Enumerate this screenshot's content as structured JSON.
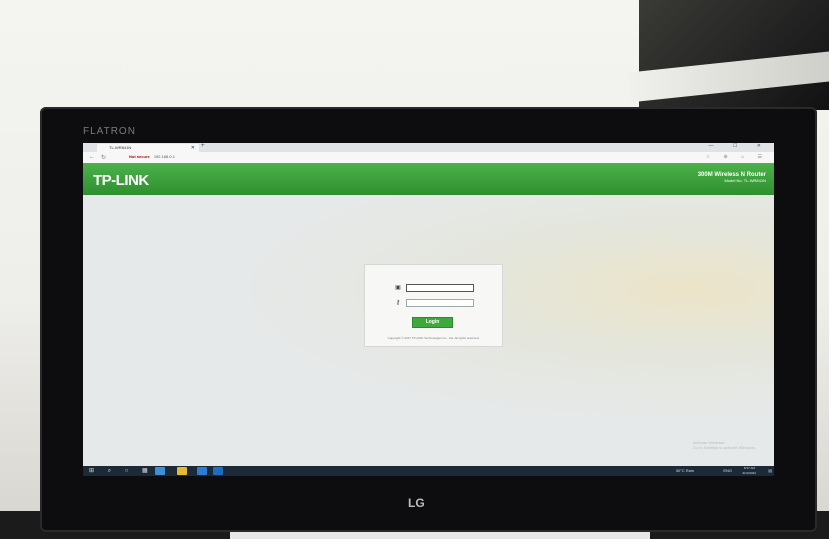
{
  "monitor": {
    "brand": "FLATRON",
    "maker": "LG"
  },
  "browser": {
    "tab_title": "TL-WR841N",
    "new_tab": "+",
    "window_controls": "— ☐ ✕",
    "address": {
      "warning": "Not secure",
      "url": "192.168.0.1"
    },
    "toolbar_icons": "☆ ⊕ ⌂ ☰"
  },
  "router": {
    "logo": "TP-LINK",
    "model_title": "300M Wireless N Router",
    "model_number": "Model No. TL-WR841N"
  },
  "login": {
    "username_value": "",
    "password_value": "",
    "button_label": "Login",
    "copyright": "Copyright © 2017 TP-LINK Technologies Co., Ltd. All rights reserved."
  },
  "activate": {
    "line1": "Activate Windows",
    "line2": "Go to Settings to activate Windows."
  },
  "taskbar": {
    "left_icons": "⊞ ⌕ ○ ▦",
    "weather": "30°C Rain",
    "tray": "ENG",
    "time": "8:37 AM",
    "date": "9/13/2022"
  }
}
